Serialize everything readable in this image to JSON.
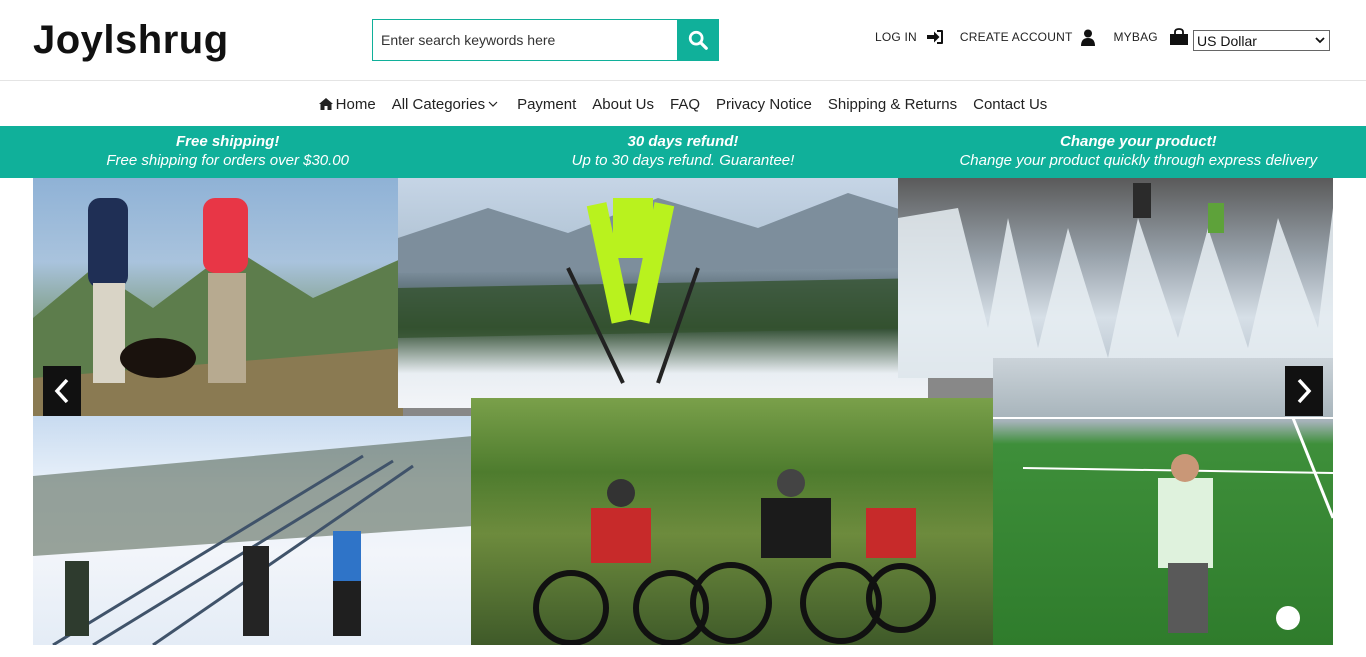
{
  "brand": {
    "name": "Joylshrug"
  },
  "search": {
    "placeholder": "Enter search keywords here",
    "icon": "search-icon"
  },
  "account": {
    "login_label": "LOG IN",
    "create_label": "CREATE ACCOUNT",
    "bag_label": "MYBAG"
  },
  "currency": {
    "selected": "US Dollar"
  },
  "nav": {
    "items": [
      {
        "label": "Home",
        "icon": "home-icon"
      },
      {
        "label": "All Categories",
        "icon": "chevron-down-icon"
      },
      {
        "label": "Payment"
      },
      {
        "label": "About Us"
      },
      {
        "label": "FAQ"
      },
      {
        "label": "Privacy Notice"
      },
      {
        "label": "Shipping & Returns"
      },
      {
        "label": "Contact Us"
      }
    ]
  },
  "promo": [
    {
      "title": "Free shipping!",
      "subtitle": "Free shipping for orders over $30.00"
    },
    {
      "title": "30 days refund!",
      "subtitle": "Up to 30 days refund. Guarantee!"
    },
    {
      "title": "Change your product!",
      "subtitle": "Change your product quickly through express delivery"
    }
  ],
  "colors": {
    "accent": "#10b09a",
    "text": "#222222"
  }
}
